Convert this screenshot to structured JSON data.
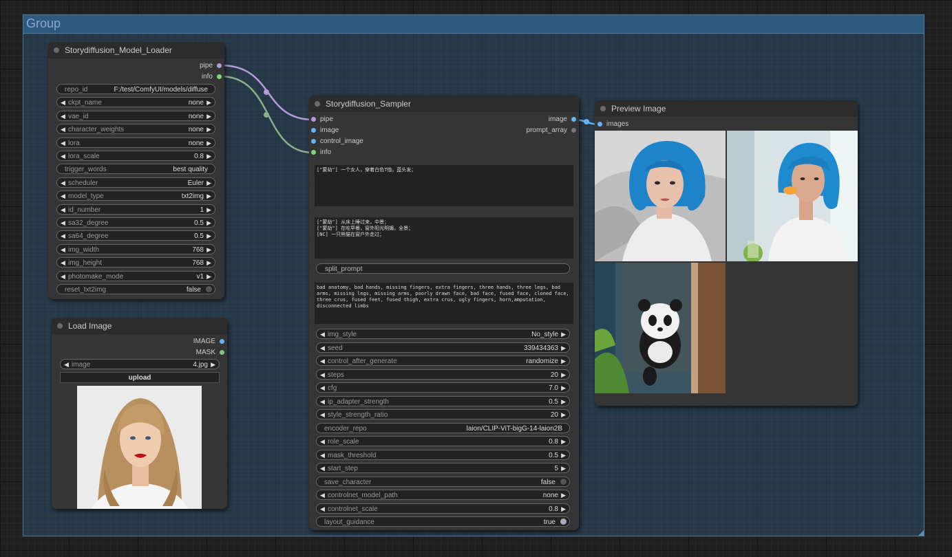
{
  "group": {
    "title": "Group"
  },
  "model_loader": {
    "title": "Storydiffusion_Model_Loader",
    "outputs": [
      "pipe",
      "info"
    ],
    "widgets": [
      {
        "label": "repo_id",
        "value": "F:/test/ComfyUI/models/diffuse",
        "kind": "plain"
      },
      {
        "label": "ckpt_name",
        "value": "none",
        "kind": "combo"
      },
      {
        "label": "vae_id",
        "value": "none",
        "kind": "combo"
      },
      {
        "label": "character_weights",
        "value": "none",
        "kind": "combo"
      },
      {
        "label": "lora",
        "value": "none",
        "kind": "combo"
      },
      {
        "label": "lora_scale",
        "value": "0.8",
        "kind": "combo"
      },
      {
        "label": "trigger_words",
        "value": "best quality",
        "kind": "plain"
      },
      {
        "label": "scheduler",
        "value": "Euler",
        "kind": "combo"
      },
      {
        "label": "model_type",
        "value": "txt2img",
        "kind": "combo"
      },
      {
        "label": "id_number",
        "value": "1",
        "kind": "combo"
      },
      {
        "label": "sa32_degree",
        "value": "0.5",
        "kind": "combo"
      },
      {
        "label": "sa64_degree",
        "value": "0.5",
        "kind": "combo"
      },
      {
        "label": "img_width",
        "value": "768",
        "kind": "combo"
      },
      {
        "label": "img_height",
        "value": "768",
        "kind": "combo"
      },
      {
        "label": "photomake_mode",
        "value": "v1",
        "kind": "combo"
      },
      {
        "label": "reset_txt2img",
        "value": "false",
        "kind": "toggle",
        "on": false
      }
    ]
  },
  "load_image": {
    "title": "Load Image",
    "outputs": [
      "IMAGE",
      "MASK"
    ],
    "image_widget": {
      "label": "image",
      "value": "4.jpg"
    },
    "upload_label": "upload"
  },
  "sampler": {
    "title": "Storydiffusion_Sampler",
    "inputs": [
      "pipe",
      "image",
      "control_image",
      "info"
    ],
    "outputs": [
      "image",
      "prompt_array"
    ],
    "character_prompt": "[\"蒙劫\"] 一个女人，穿着白色T恤，蓝头发；",
    "scene_prompts": "[\"蒙劫\"] 从床上睡过来，中景；\n[\"蒙劫\"] 在吃早餐，窗外阳光明媚，全景；\n[NC] 一只熊猫在窗户外走过；",
    "split_prompt_label": "split_prompt",
    "negative_prompt": "bad anatomy, bad hands, missing fingers, extra fingers, three hands, three legs, bad arms, missing legs, missing arms, poorly drawn face, bad face, fused face, cloned face, three crus, fused feet, fused thigh, extra crus, ugly fingers, horn,amputation, disconnected limbs",
    "widgets": [
      {
        "label": "img_style",
        "value": "No_style",
        "kind": "combo"
      },
      {
        "label": "seed",
        "value": "339434363",
        "kind": "combo"
      },
      {
        "label": "control_after_generate",
        "value": "randomize",
        "kind": "combo"
      },
      {
        "label": "steps",
        "value": "20",
        "kind": "combo"
      },
      {
        "label": "cfg",
        "value": "7.0",
        "kind": "combo"
      },
      {
        "label": "ip_adapter_strength",
        "value": "0.5",
        "kind": "combo"
      },
      {
        "label": "style_strength_ratio",
        "value": "20",
        "kind": "combo"
      },
      {
        "label": "encoder_repo",
        "value": "laion/CLIP-ViT-bigG-14-laion2B",
        "kind": "plain"
      },
      {
        "label": "role_scale",
        "value": "0.8",
        "kind": "combo"
      },
      {
        "label": "mask_threshold",
        "value": "0.5",
        "kind": "combo"
      },
      {
        "label": "start_step",
        "value": "5",
        "kind": "combo"
      },
      {
        "label": "save_character",
        "value": "false",
        "kind": "toggle",
        "on": false
      },
      {
        "label": "controlnet_model_path",
        "value": "none",
        "kind": "combo"
      },
      {
        "label": "controlnet_scale",
        "value": "0.8",
        "kind": "combo"
      },
      {
        "label": "layout_guidance",
        "value": "true",
        "kind": "toggle",
        "on": true
      }
    ]
  },
  "preview": {
    "title": "Preview Image",
    "inputs": [
      "images"
    ]
  },
  "colors": {
    "pipe": "#b39ddb",
    "info": "#7dd87a",
    "image": "#64b5f6",
    "group": "#2f5a80"
  }
}
